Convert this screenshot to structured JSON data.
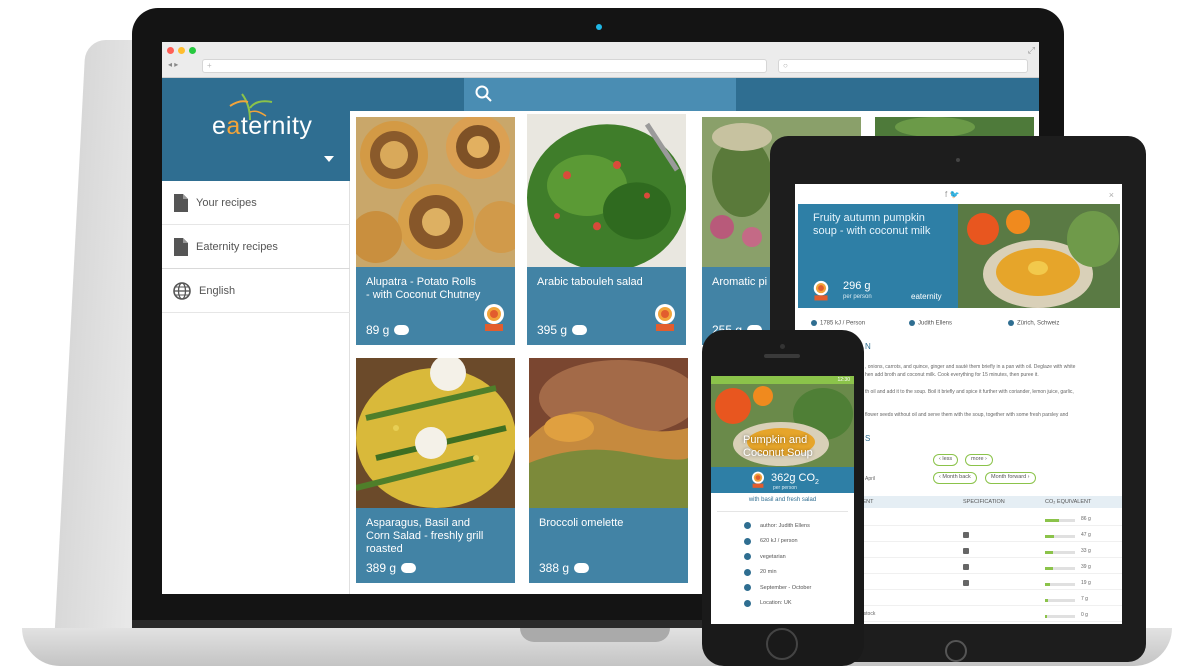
{
  "browser": {
    "url_placeholder": "",
    "search_placeholder": "",
    "nav_arrows": "◂ ▸",
    "url_icon": "+",
    "search_icon_glyph": "○"
  },
  "app": {
    "logo_text_main": "e",
    "logo_text_accent": "a",
    "logo_text_rest": "ternity",
    "accent_color": "#2f6e91",
    "header_color": "#4a8db3"
  },
  "sidebar": {
    "items": [
      {
        "label": "Your recipes",
        "icon": "document-icon"
      },
      {
        "label": "Eaternity recipes",
        "icon": "document-icon"
      },
      {
        "label": "English",
        "icon": "globe-icon"
      }
    ]
  },
  "recipes": [
    {
      "title": "Alupatra - Potato Rolls - with Coconut Chutney",
      "co2": "89 g",
      "award": true
    },
    {
      "title": "Arabic tabouleh salad",
      "co2": "395 g",
      "award": true
    },
    {
      "title": "Aromatic pi pesto",
      "co2": "255 g",
      "award": false
    },
    {
      "title": "",
      "co2": "",
      "award": false
    },
    {
      "title": "Asparagus, Basil and Corn Salad - freshly grill roasted",
      "co2": "389 g",
      "award": false
    },
    {
      "title": "Broccoli omelette",
      "co2": "388 g",
      "award": false
    }
  ],
  "tablet": {
    "social": "f  🐦",
    "close": "×",
    "recipe_title": "Fruity autumn pumpkin soup - with coconut milk",
    "co2": "296 g",
    "per": "per person",
    "logo": "eaternity",
    "energy": "1785 kJ / Person",
    "author": "Judith Ellens",
    "location": "Zürich, Schweiz",
    "heading": "N",
    "text_1": ", onions, carrots, and quince, ginger and sauté them briefly in a pan with oil. Deglaze with white",
    "text_2": "hen add broth and coconut milk. Cook everything for 15 minutes, then puree it.",
    "text_3": "th oil and add it to the soup. Boil it briefly and spice it further with coriander, lemon juice, garlic,",
    "text_4": "flower seeds without oil and serve them with the soup, together with some fresh parsley and",
    "heading_2": "S",
    "april": "April",
    "pill_less": "‹  less",
    "pill_more": "more  ›",
    "pill_back": "‹  Month back",
    "pill_forward": "Month forward  ›",
    "col_ingredient": "DIENT",
    "col_spec": "SPECIFICATION",
    "col_co2": "CO₂ EQUIVALENT",
    "row_values": [
      "86 g",
      "47 g",
      "33 g",
      "39 g",
      "19 g",
      "7 g",
      "0 g"
    ],
    "row_fill": [
      0.45,
      0.3,
      0.25,
      0.28,
      0.15,
      0.1,
      0.05
    ],
    "last_ingredient": "ds stock"
  },
  "phone": {
    "recipe_title_1": "Pumpkin and",
    "recipe_title_2": "Coconut Soup",
    "co2": "362g CO",
    "co2_sub": "2",
    "per": "per person",
    "subtitle": "with basil and fresh salad",
    "status_time": "12:30",
    "details": [
      "author: Judith Ellens",
      "620 kJ / person",
      "vegetarian",
      "20 min",
      "September - October",
      "Location: UK"
    ]
  }
}
